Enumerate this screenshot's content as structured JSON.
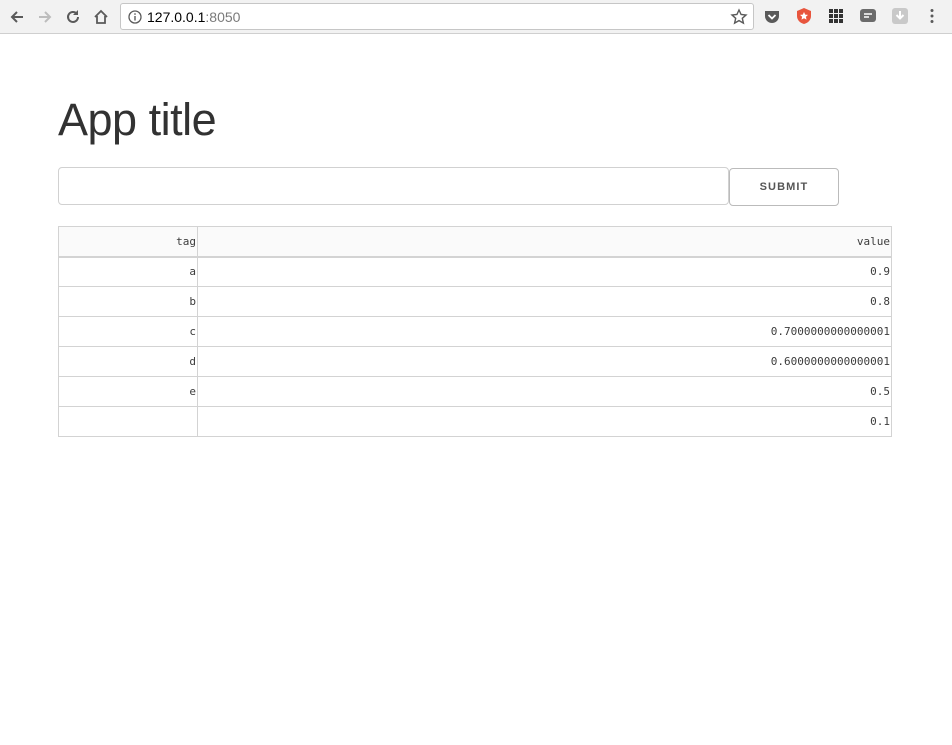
{
  "browser": {
    "url_host": "127.0.0.1",
    "url_port": ":8050"
  },
  "page": {
    "title": "App title"
  },
  "form": {
    "input_value": "",
    "submit_label": "SUBMIT"
  },
  "table": {
    "columns": [
      "tag",
      "value"
    ],
    "rows": [
      {
        "tag": "a",
        "value": "0.9"
      },
      {
        "tag": "b",
        "value": "0.8"
      },
      {
        "tag": "c",
        "value": "0.7000000000000001"
      },
      {
        "tag": "d",
        "value": "0.6000000000000001"
      },
      {
        "tag": "e",
        "value": "0.5"
      },
      {
        "tag": "",
        "value": "0.1"
      }
    ]
  }
}
